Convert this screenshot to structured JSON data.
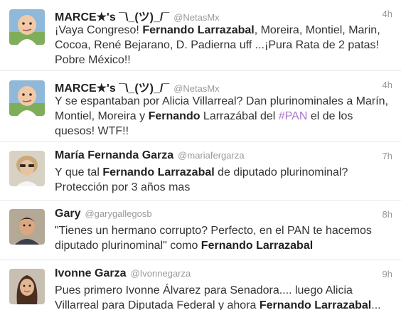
{
  "tweets": [
    {
      "name": "MARCE★'s ¯\\_(ツ)_/¯",
      "handle": "@NetasMx",
      "time": "4h",
      "avatar": "baby-avatar",
      "segments": [
        {
          "t": "¡Vaya Congreso! "
        },
        {
          "t": "Fernando Larrazabal",
          "b": true
        },
        {
          "t": ", Moreira, Montiel, Marin, Cocoa, René Bejarano, D. Padierna uff ...¡Pura Rata de 2 patas! Pobre México!!"
        }
      ]
    },
    {
      "name": "MARCE★'s ¯\\_(ツ)_/¯",
      "handle": "@NetasMx",
      "time": "4h",
      "avatar": "baby-avatar",
      "segments": [
        {
          "t": "Y se espantaban por Alicia Villarreal? Dan plurinominales a Marín, Montiel, Moreira y "
        },
        {
          "t": "Fernando",
          "b": true
        },
        {
          "t": " Larrazábal del "
        },
        {
          "t": "#PAN",
          "h": true
        },
        {
          "t": " el de los quesos! WTF!!"
        }
      ]
    },
    {
      "name": "María Fernanda Garza",
      "handle": "@mariafergarza",
      "time": "7h",
      "avatar": "woman-sunglasses-avatar",
      "segments": [
        {
          "t": "Y que tal "
        },
        {
          "t": "Fernando Larrazabal",
          "b": true
        },
        {
          "t": " de diputado plurinominal? Protección por 3 años mas"
        }
      ]
    },
    {
      "name": "Gary",
      "handle": "@garygallegosb",
      "time": "8h",
      "avatar": "man-avatar",
      "segments": [
        {
          "t": "\"Tienes un hermano corrupto? Perfecto, en el PAN te hacemos diputado plurinominal\" como "
        },
        {
          "t": "Fernando Larrazabal",
          "b": true
        }
      ]
    },
    {
      "name": "Ivonne Garza",
      "handle": "@Ivonnegarza",
      "time": "9h",
      "avatar": "woman-avatar",
      "segments": [
        {
          "t": "Pues primero Ivonne Álvarez para Senadora.... luego Alicia Villarreal para Diputada Federal y ahora "
        },
        {
          "t": "Fernando Larrazabal",
          "b": true
        },
        {
          "t": "..."
        }
      ]
    }
  ],
  "colors": {
    "hashtag": "#a877c9",
    "meta": "#999999",
    "divider": "#e1e8ed"
  }
}
